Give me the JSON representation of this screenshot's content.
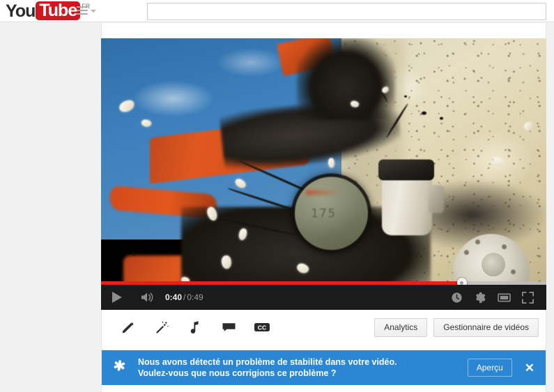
{
  "header": {
    "logo_you": "You",
    "logo_tube": "Tube",
    "country_code": "FR",
    "menu_icon": "hamburger-menu-icon",
    "search": {
      "value": "",
      "placeholder": ""
    }
  },
  "player": {
    "current_time": "0:40",
    "time_separator": "/",
    "duration": "0:49",
    "progress_percent": 81,
    "play_icon": "play-icon",
    "volume_icon": "volume-icon",
    "right_controls": [
      {
        "name": "watch-later-icon",
        "label": "Regarder plus tard"
      },
      {
        "name": "settings-gear-icon",
        "label": "Paramètres"
      },
      {
        "name": "theater-mode-icon",
        "label": "Mode cinéma"
      },
      {
        "name": "fullscreen-icon",
        "label": "Plein écran"
      }
    ],
    "progress_color": "#e62117",
    "bar_color": "#1b1b1b"
  },
  "edit_toolbar": {
    "icons": [
      {
        "name": "edit-pencil-icon",
        "label": "Améliorations"
      },
      {
        "name": "magic-wand-icon",
        "label": "Effets magiques"
      },
      {
        "name": "audio-note-icon",
        "label": "Audio"
      },
      {
        "name": "annotations-icon",
        "label": "Annotations"
      },
      {
        "name": "captions-cc-icon",
        "label": "CC"
      }
    ],
    "analytics_label": "Analytics",
    "video_manager_label": "Gestionnaire de vidéos"
  },
  "banner": {
    "icon": "sparkle-star-icon",
    "line1": "Nous avons détecté un problème de stabilité dans votre vidéo.",
    "line2": "Voulez-vous que nous corrigions ce problème ?",
    "preview_label": "Aperçu",
    "close_label": "✕",
    "background_color": "#2b87d4"
  }
}
